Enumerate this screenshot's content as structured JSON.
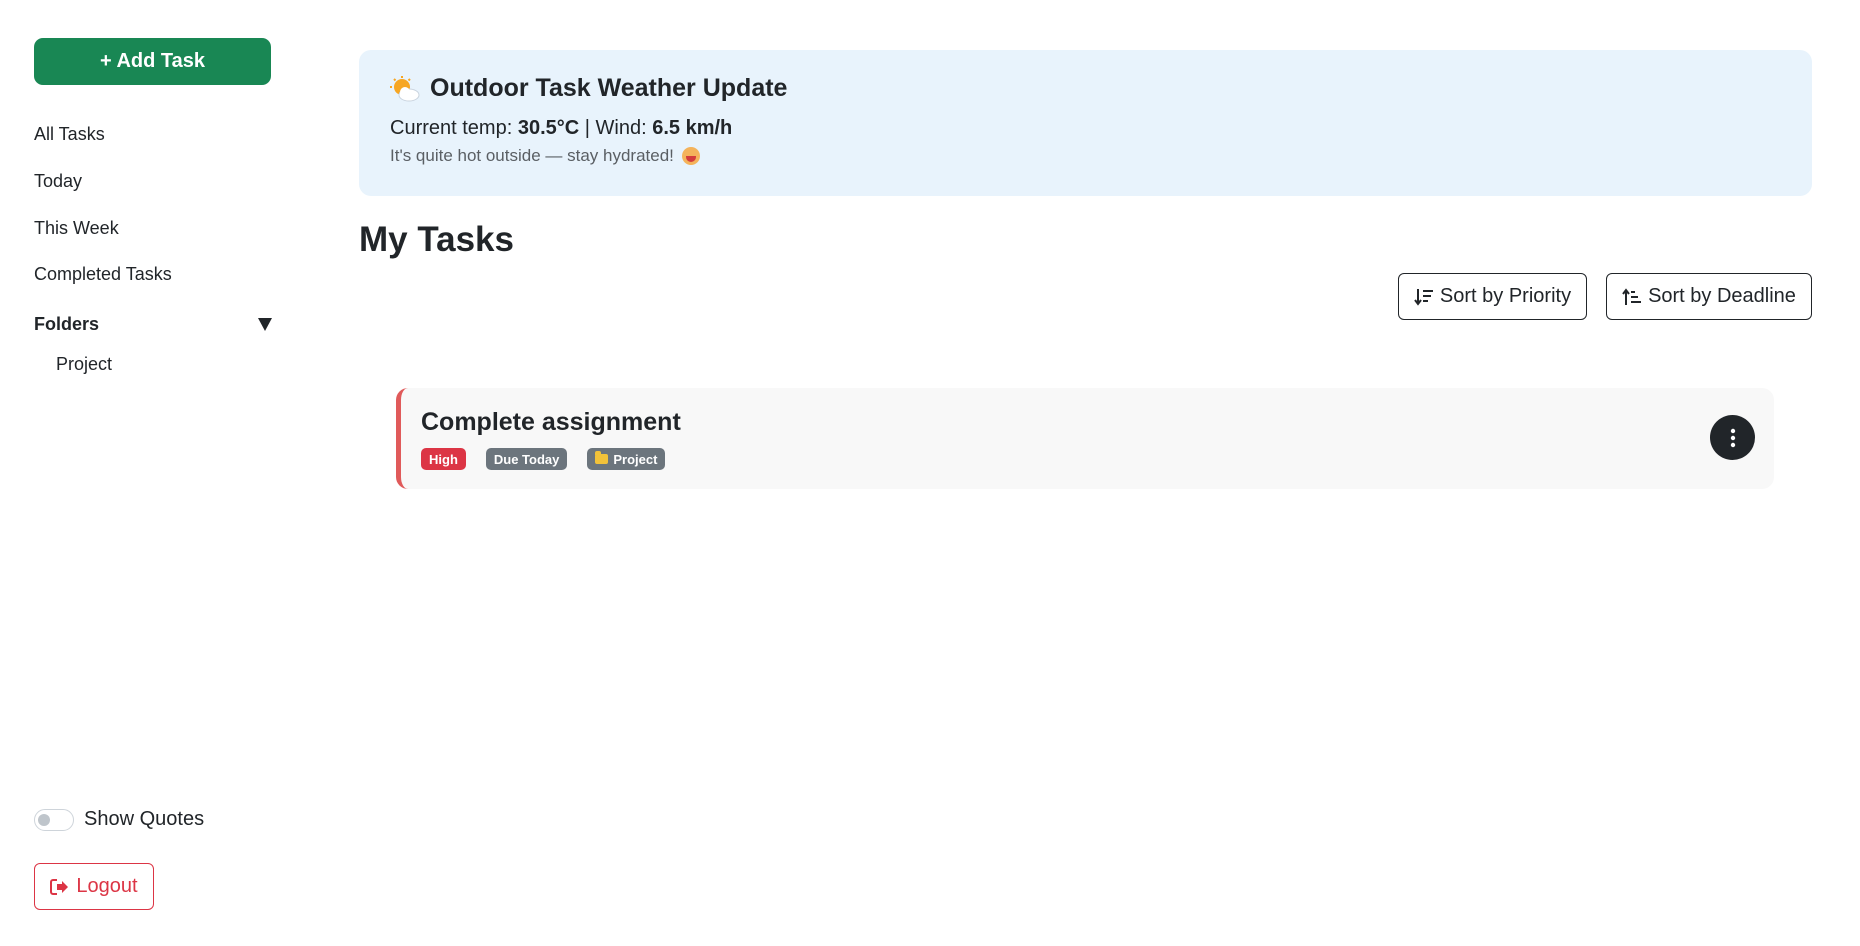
{
  "sidebar": {
    "add_task_label": "+ Add Task",
    "nav": {
      "all": "All Tasks",
      "today": "Today",
      "week": "This Week",
      "completed": "Completed Tasks"
    },
    "folders_label": "Folders",
    "folders": [
      "Project"
    ],
    "show_quotes_label": "Show Quotes",
    "show_quotes_enabled": false,
    "logout_label": "Logout"
  },
  "weather": {
    "title": "Outdoor Task Weather Update",
    "temp_label": "Current temp:",
    "temp_value": "30.5°C",
    "separator": "|",
    "wind_label": "Wind:",
    "wind_value": "6.5 km/h",
    "note": "It's quite hot outside — stay hydrated!"
  },
  "main": {
    "title": "My Tasks",
    "sort_priority_label": "Sort by Priority",
    "sort_deadline_label": "Sort by Deadline"
  },
  "tasks": [
    {
      "title": "Complete assignment",
      "priority": "High",
      "due": "Due Today",
      "folder": "Project"
    }
  ],
  "colors": {
    "add_button": "#198754",
    "weather_bg": "#e8f3fc",
    "high_badge": "#dc3545",
    "gray_badge": "#6c757d",
    "logout": "#dc3545",
    "task_accent": "#e05a5a"
  },
  "icons": {
    "weather": "sun-behind-cloud-icon",
    "hot": "hot-face-icon",
    "folders_toggle": "caret-down-icon",
    "sort_priority": "sort-amount-down-icon",
    "sort_deadline": "sort-numeric-up-icon",
    "task_menu": "kebab-menu-icon",
    "logout": "logout-icon",
    "folder_badge": "folder-icon"
  }
}
